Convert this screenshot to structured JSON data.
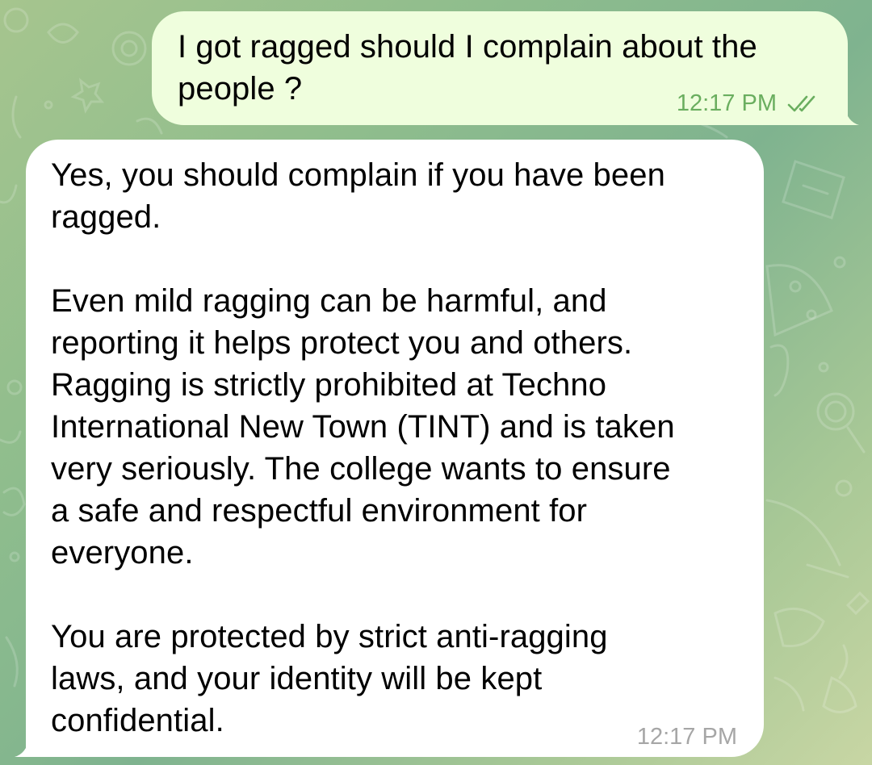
{
  "chat": {
    "messages": [
      {
        "direction": "outgoing",
        "text": "I got ragged should I complain about the\npeople ?",
        "time": "12:17 PM",
        "status_icon": "double-check-icon"
      },
      {
        "direction": "incoming",
        "text": "Yes, you should complain if you have been\nragged.\n\nEven mild ragging can be harmful, and\nreporting it helps protect you and others.\nRagging is strictly prohibited at Techno\nInternational New Town (TINT) and is taken\nvery seriously. The college wants to ensure\na safe and respectful environment for\neveryone.\n\nYou are protected by strict anti-ragging\nlaws, and your identity will be kept\nconfidential.",
        "time": "12:17 PM"
      }
    ]
  },
  "colors": {
    "outgoing_bubble": "#effedd",
    "incoming_bubble": "#ffffff",
    "outgoing_meta": "#6aae5f",
    "incoming_meta": "#a6a6a6",
    "wallpaper": "#8fbd8d"
  }
}
